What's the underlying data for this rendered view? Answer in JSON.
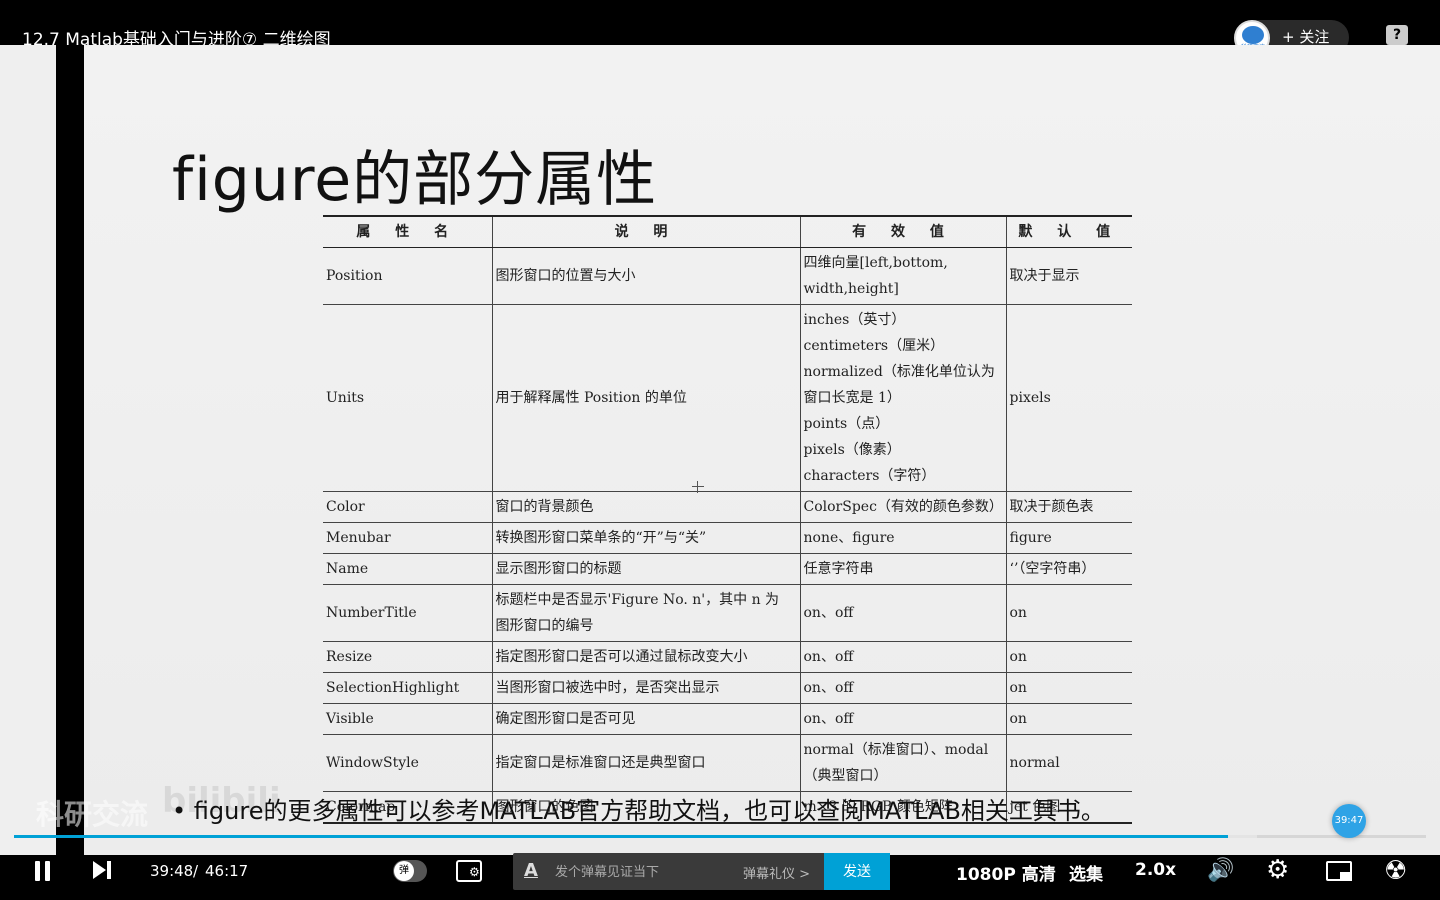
{
  "header": {
    "video_title": "12.7 Matlab基础入门与进阶⑦ 二维绘图",
    "follow_label": "+ 关注",
    "uploader_avatar_text": "科研交流",
    "help_icon": "?"
  },
  "slide": {
    "title": "figure的部分属性",
    "table": {
      "headers": [
        "属 性 名",
        "说 明",
        "有 效 值",
        "默 认 值"
      ],
      "rows": [
        [
          "Position",
          "图形窗口的位置与大小",
          "四维向量[left,bottom,\nwidth,height]",
          "取决于显示"
        ],
        [
          "Units",
          "用于解释属性 Position 的单位",
          "inches（英寸）\ncentimeters（厘米）\nnormalized（标准化单位认为\n窗口长宽是 1）\npoints（点）\npixels（像素）\ncharacters（字符）",
          "pixels"
        ],
        [
          "Color",
          "窗口的背景颜色",
          "ColorSpec（有效的颜色参数）",
          "取决于颜色表"
        ],
        [
          "Menubar",
          "转换图形窗口菜单条的“开”与“关”",
          "none、figure",
          "figure"
        ],
        [
          "Name",
          "显示图形窗口的标题",
          "任意字符串",
          "‘’（空字符串）"
        ],
        [
          "NumberTitle",
          "标题栏中是否显示'Figure No. n'，其中 n 为\n图形窗口的编号",
          "on、off",
          "on"
        ],
        [
          "Resize",
          "指定图形窗口是否可以通过鼠标改变大小",
          "on、off",
          "on"
        ],
        [
          "SelectionHighlight",
          "当图形窗口被选中时，是否突出显示",
          "on、off",
          "on"
        ],
        [
          "Visible",
          "确定图形窗口是否可见",
          "on、off",
          "on"
        ],
        [
          "WindowStyle",
          "指定窗口是标准窗口还是典型窗口",
          "normal（标准窗口）、modal\n（典型窗口）",
          "normal"
        ],
        [
          "Colormap",
          "图形窗口的色图",
          "m×3 的 RGB 颜色矩阵",
          "jet 色图"
        ]
      ]
    },
    "bullet_text": "•  figure的更多属性可以参考MATLAB官方帮助文档，也可以查阅MATLAB相关工具书。",
    "watermark": "科研交流",
    "watermark2": "bilibili"
  },
  "player": {
    "progress_fraction": 0.86,
    "buffered_fraction": 0.88,
    "seek_bubble_time": "39:47",
    "time_current": "39:48",
    "time_separator": "/",
    "time_total": "46:17",
    "danmaku_toggle_label": "弹",
    "danmaku_font_icon": "A",
    "danmaku_placeholder": "发个弹幕见证当下",
    "danmaku_etiquette": "弹幕礼仪 >",
    "send_label": "发送",
    "quality_label": "1080P 高清",
    "episodes_label": "选集",
    "speed_label": "2.0x",
    "accent_color": "#00a1d6"
  }
}
